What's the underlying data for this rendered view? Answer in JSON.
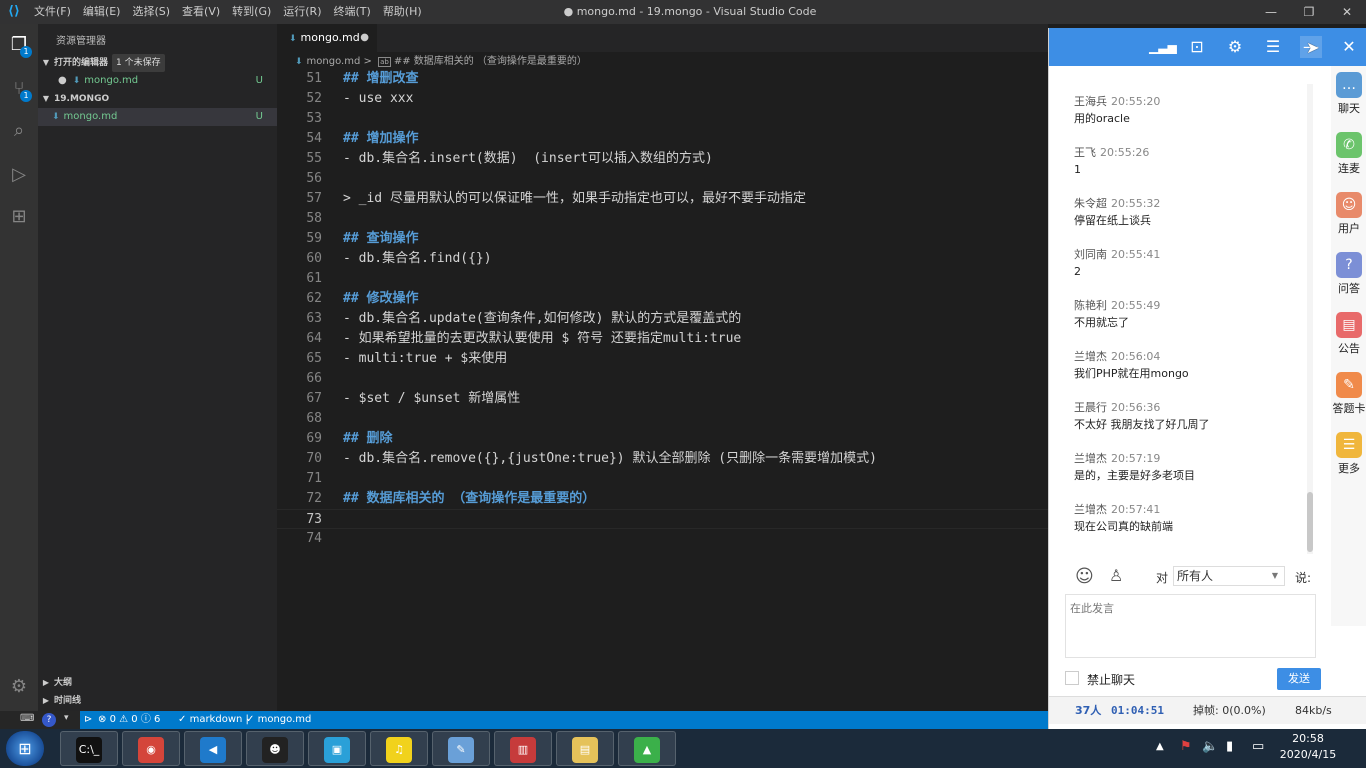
{
  "titlebar": {
    "menu": [
      "文件(F)",
      "编辑(E)",
      "选择(S)",
      "查看(V)",
      "转到(G)",
      "运行(R)",
      "终端(T)",
      "帮助(H)"
    ],
    "title": "● mongo.md - 19.mongo - Visual Studio Code"
  },
  "activity": {
    "explorer_badge": "1",
    "scm_badge": "1"
  },
  "sidebar": {
    "title": "资源管理器",
    "open_editors_label": "打开的编辑器",
    "unsaved_label": "1 个未保存",
    "open_file": "mongo.md",
    "open_file_status": "U",
    "folder_label": "19.MONGO",
    "folder_file": "mongo.md",
    "folder_file_status": "U",
    "outline_label": "大纲",
    "timeline_label": "时间线"
  },
  "editor": {
    "tab_label": "mongo.md",
    "tab_dirty": "●",
    "breadcrumb_file": "mongo.md",
    "breadcrumb_sep": ">",
    "breadcrumb_symbol": "## 数据库相关的 （查询操作是最重要的）",
    "lines": [
      {
        "n": "51",
        "text": "## 增删改查",
        "kind": "heading"
      },
      {
        "n": "52",
        "text": "- use xxx",
        "kind": "text"
      },
      {
        "n": "53",
        "text": "",
        "kind": "text"
      },
      {
        "n": "54",
        "text": "## 增加操作",
        "kind": "heading"
      },
      {
        "n": "55",
        "text": "- db.集合名.insert(数据)  (insert可以插入数组的方式)",
        "kind": "text"
      },
      {
        "n": "56",
        "text": "",
        "kind": "text"
      },
      {
        "n": "57",
        "text": "> _id 尽量用默认的可以保证唯一性，如果手动指定也可以，最好不要手动指定",
        "kind": "text"
      },
      {
        "n": "58",
        "text": "",
        "kind": "text"
      },
      {
        "n": "59",
        "text": "## 查询操作",
        "kind": "heading"
      },
      {
        "n": "60",
        "text": "- db.集合名.find({})",
        "kind": "text"
      },
      {
        "n": "61",
        "text": "",
        "kind": "text"
      },
      {
        "n": "62",
        "text": "## 修改操作",
        "kind": "heading"
      },
      {
        "n": "63",
        "text": "- db.集合名.update(查询条件,如何修改) 默认的方式是覆盖式的",
        "kind": "text"
      },
      {
        "n": "64",
        "text": "- 如果希望批量的去更改默认要使用 $ 符号 还要指定multi:true",
        "kind": "text"
      },
      {
        "n": "65",
        "text": "- multi:true + $来使用",
        "kind": "text"
      },
      {
        "n": "66",
        "text": "",
        "kind": "text"
      },
      {
        "n": "67",
        "text": "- $set / $unset 新增属性",
        "kind": "text"
      },
      {
        "n": "68",
        "text": "",
        "kind": "text"
      },
      {
        "n": "69",
        "text": "## 删除",
        "kind": "heading"
      },
      {
        "n": "70",
        "text": "- db.集合名.remove({},{justOne:true}) 默认全部删除 (只删除一条需要增加模式)",
        "kind": "text"
      },
      {
        "n": "71",
        "text": "",
        "kind": "text"
      },
      {
        "n": "72",
        "text": "## 数据库相关的 （查询操作是最重要的）",
        "kind": "heading"
      },
      {
        "n": "73",
        "text": "",
        "kind": "current"
      },
      {
        "n": "74",
        "text": "",
        "kind": "text"
      }
    ]
  },
  "statusbar": {
    "errors": "0",
    "warnings": "0",
    "info": "6",
    "language": "markdown",
    "file": "mongo.md"
  },
  "chat": {
    "messages": [
      {
        "name": "王海兵",
        "time": "20:55:20",
        "text": "用的oracle"
      },
      {
        "name": "王飞",
        "time": "20:55:26",
        "text": "1"
      },
      {
        "name": "朱令超",
        "time": "20:55:32",
        "text": "停留在纸上谈兵"
      },
      {
        "name": "刘同南",
        "time": "20:55:41",
        "text": "2"
      },
      {
        "name": "陈艳利",
        "time": "20:55:49",
        "text": "不用就忘了"
      },
      {
        "name": "兰增杰",
        "time": "20:56:04",
        "text": "我们PHP就在用mongo"
      },
      {
        "name": "王晨行",
        "time": "20:56:36",
        "text": "不太好      我朋友找了好几周了"
      },
      {
        "name": "兰增杰",
        "time": "20:57:19",
        "text": "是的，主要是好多老项目"
      },
      {
        "name": "兰增杰",
        "time": "20:57:41",
        "text": "现在公司真的缺前端"
      }
    ],
    "side_tabs": [
      {
        "label": "聊天",
        "color": "#5b9bd5",
        "icon": "…"
      },
      {
        "label": "连麦",
        "color": "#6cc46c",
        "icon": "✆"
      },
      {
        "label": "用户",
        "color": "#e88a6a",
        "icon": "☺"
      },
      {
        "label": "问答",
        "color": "#7c8fd6",
        "icon": "?"
      },
      {
        "label": "公告",
        "color": "#e86a6a",
        "icon": "▤"
      },
      {
        "label": "答题卡",
        "color": "#f08a4a",
        "icon": "✎"
      },
      {
        "label": "更多",
        "color": "#f0b63c",
        "icon": "☰"
      }
    ],
    "to_label": "对",
    "to_value": "所有人",
    "say_label": "说:",
    "input_placeholder": "在此发言",
    "mute_label": "禁止聊天",
    "send_label": "发送",
    "status_people": "37人",
    "status_time": "01:04:51",
    "status_drop": "掉帧: 0(0.0%)",
    "status_speed": "84kb/s"
  },
  "taskbar": {
    "time": "20:58",
    "date": "2020/4/15",
    "apps": [
      {
        "name": "cmd",
        "color": "#111111",
        "glyph": "C:\\_"
      },
      {
        "name": "chrome",
        "color": "#d4453a",
        "glyph": "◉"
      },
      {
        "name": "vscode",
        "color": "#1f7acb",
        "glyph": "◀"
      },
      {
        "name": "qq",
        "color": "#222222",
        "glyph": "☻"
      },
      {
        "name": "live",
        "color": "#2aa0d8",
        "glyph": "▣"
      },
      {
        "name": "music",
        "color": "#f1d21c",
        "glyph": "♫"
      },
      {
        "name": "paint",
        "color": "#6aa0d8",
        "glyph": "✎"
      },
      {
        "name": "toolbox",
        "color": "#c63b3b",
        "glyph": "▥"
      },
      {
        "name": "explorer",
        "color": "#e5c25a",
        "glyph": "▤"
      },
      {
        "name": "android",
        "color": "#3bb04a",
        "glyph": "▲"
      }
    ]
  }
}
